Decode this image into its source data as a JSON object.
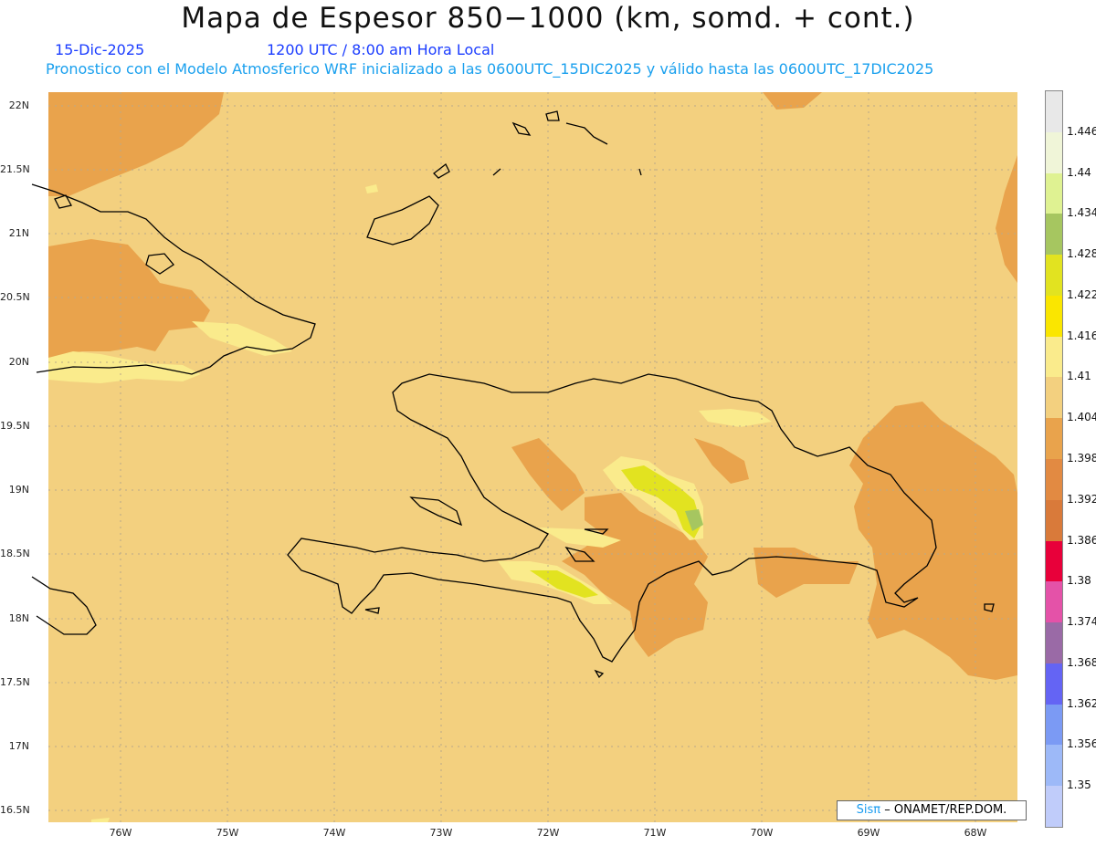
{
  "title": "Mapa de Espesor 850−1000 (km, somd. + cont.)",
  "date": "15-Dic-2025",
  "time": "1200 UTC / 8:00 am Hora Local",
  "description": "Pronostico con el Modelo Atmosferico WRF inicializado a las 0600UTC_15DIC2025 y válido hasta las  0600UTC_17DIC2025",
  "credit": {
    "logo": "Sisπ",
    "text": "– ONAMET/REP.DOM."
  },
  "lat_labels": [
    "22N",
    "21.5N",
    "21N",
    "20.5N",
    "20N",
    "19.5N",
    "19N",
    "18.5N",
    "18N",
    "17.5N",
    "17N",
    "16.5N"
  ],
  "lon_labels": [
    "76W",
    "75W",
    "74W",
    "73W",
    "72W",
    "71W",
    "70W",
    "69W",
    "68W"
  ],
  "colorbar": {
    "labels": [
      "1.446",
      "1.44",
      "1.434",
      "1.428",
      "1.422",
      "1.416",
      "1.41",
      "1.404",
      "1.398",
      "1.392",
      "1.386",
      "1.38",
      "1.374",
      "1.368",
      "1.362",
      "1.356",
      "1.35"
    ],
    "colors": [
      "#e8e8e8",
      "#f0f5d8",
      "#dff292",
      "#a6c660",
      "#e2e320",
      "#fae600",
      "#faeb8c",
      "#f3d07f",
      "#e9a34c",
      "#e28a42",
      "#d97a3a",
      "#e8003a",
      "#e452a8",
      "#9a6aa6",
      "#6464f4",
      "#7b9af4",
      "#9db9f8",
      "#c0ccfa"
    ]
  },
  "map_colors": {
    "base": "#f3d07f",
    "warm": "#e9a34c",
    "pale": "#faeb8c",
    "yellow": "#e2e320",
    "green": "#a6c660"
  }
}
